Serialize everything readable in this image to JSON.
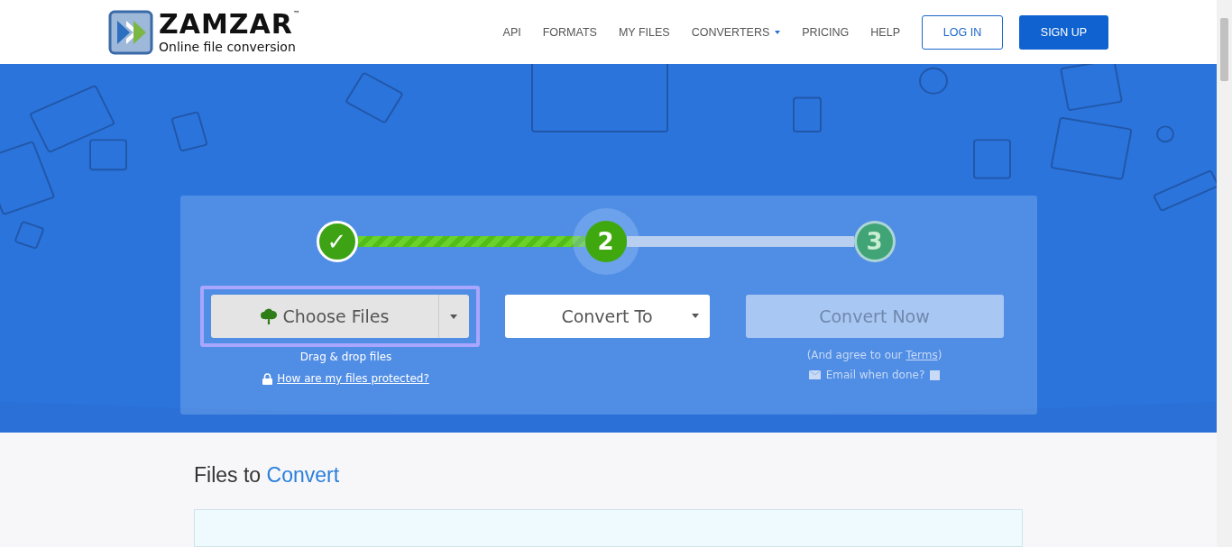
{
  "header": {
    "logo": {
      "name": "ZAMZAR",
      "trademark": "™",
      "tagline": "Online file conversion"
    },
    "nav": [
      {
        "label": "API",
        "dropdown": false
      },
      {
        "label": "FORMATS",
        "dropdown": false
      },
      {
        "label": "MY FILES",
        "dropdown": false
      },
      {
        "label": "CONVERTERS",
        "dropdown": true
      },
      {
        "label": "PRICING",
        "dropdown": false
      },
      {
        "label": "HELP",
        "dropdown": false
      }
    ],
    "login": "LOG IN",
    "signup": "SIGN UP"
  },
  "steps": [
    {
      "label": "✓",
      "completed": true,
      "selected": false
    },
    {
      "label": "2",
      "completed": false,
      "selected": true
    },
    {
      "label": "3",
      "completed": false,
      "selected": false
    }
  ],
  "choose": {
    "label": "Choose Files",
    "hint": "Drag & drop files",
    "link": "How are my files protected?"
  },
  "convert_to": {
    "label": "Convert To"
  },
  "convert_now": {
    "label": "Convert Now",
    "disabled": true,
    "agree_prefix": "(And agree to our ",
    "agree_link": "Terms",
    "agree_suffix": ")",
    "email_label": "Email when done?",
    "email_checked": false
  },
  "files_section": {
    "title": "Files to",
    "highlight": "Convert"
  }
}
